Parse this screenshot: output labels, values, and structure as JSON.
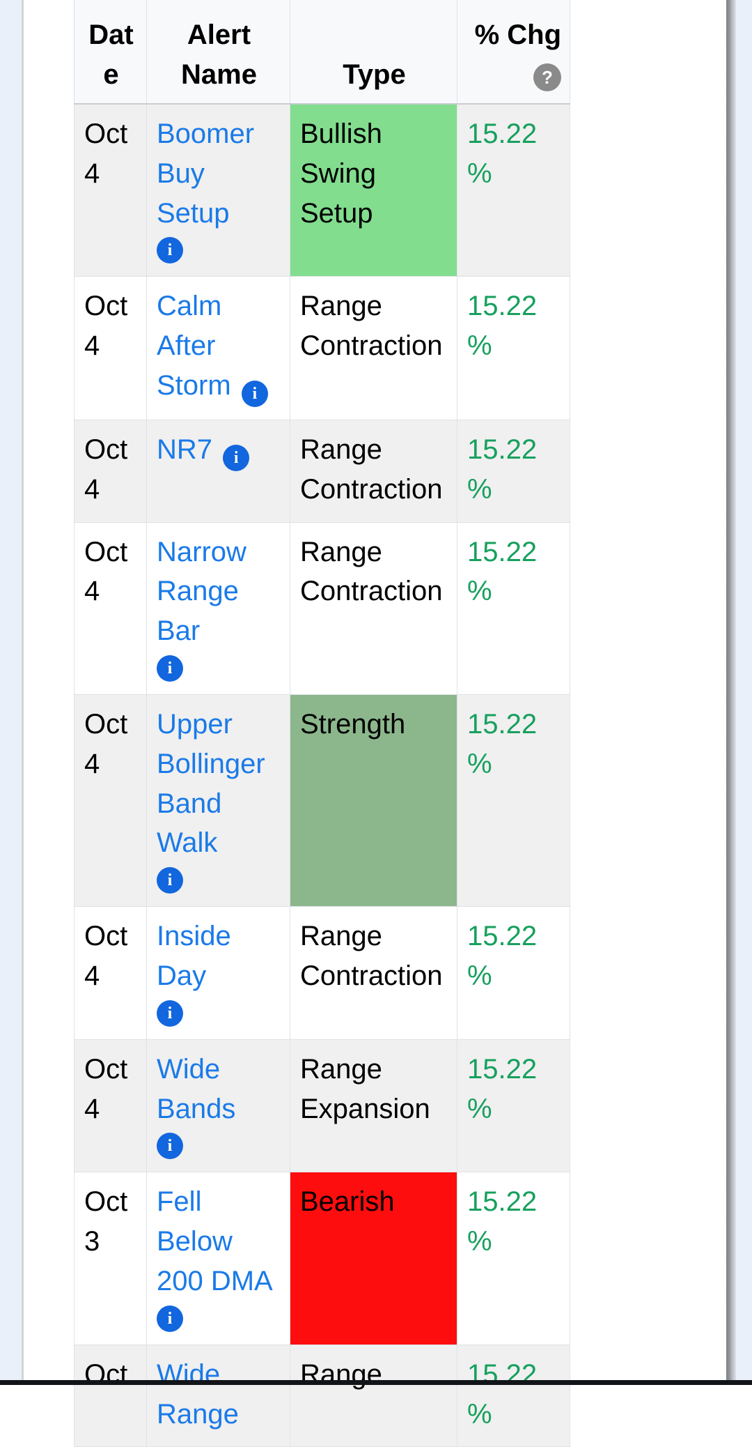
{
  "table": {
    "columns": [
      {
        "key": "date",
        "label": "Date"
      },
      {
        "key": "name",
        "label": "Alert Name"
      },
      {
        "key": "type",
        "label": "Type"
      },
      {
        "key": "chg",
        "label": "% Chg",
        "help_icon": "?"
      }
    ],
    "rows": [
      {
        "date": "Oct 4",
        "name": "Boomer Buy Setup",
        "info_icon": "i",
        "info_layout": "block",
        "type": "Bullish Swing Setup",
        "type_bg": "#82dd8e",
        "chg": "15.22%",
        "shaded": true
      },
      {
        "date": "Oct 4",
        "name": "Calm After Storm",
        "info_icon": "i",
        "info_layout": "inline",
        "type": "Range Contraction",
        "type_bg": "",
        "chg": "15.22%",
        "shaded": false
      },
      {
        "date": "Oct 4",
        "name": "NR7",
        "info_icon": "i",
        "info_layout": "inline",
        "type": "Range Contraction",
        "type_bg": "",
        "chg": "15.22%",
        "shaded": true
      },
      {
        "date": "Oct 4",
        "name": "Narrow Range Bar",
        "info_icon": "i",
        "info_layout": "block",
        "type": "Range Contraction",
        "type_bg": "",
        "chg": "15.22%",
        "shaded": false
      },
      {
        "date": "Oct 4",
        "name": "Upper Bollinger Band Walk",
        "info_icon": "i",
        "info_layout": "block",
        "type": "Strength",
        "type_bg": "#8cb78c",
        "chg": "15.22%",
        "shaded": true
      },
      {
        "date": "Oct 4",
        "name": "Inside Day",
        "info_icon": "i",
        "info_layout": "block",
        "type": "Range Contraction",
        "type_bg": "",
        "chg": "15.22%",
        "shaded": false
      },
      {
        "date": "Oct 4",
        "name": "Wide Bands",
        "info_icon": "i",
        "info_layout": "block",
        "type": "Range Expansion",
        "type_bg": "",
        "chg": "15.22%",
        "shaded": true
      },
      {
        "date": "Oct 3",
        "name": "Fell Below 200 DMA",
        "info_icon": "i",
        "info_layout": "block",
        "type": "Bearish",
        "type_bg": "#fd0d0d",
        "chg": "15.22%",
        "shaded": false
      },
      {
        "date": "Oct",
        "name": "Wide Range",
        "info_icon": "",
        "info_layout": "none",
        "type": "Range",
        "type_bg": "",
        "chg": "15.22%",
        "shaded": true
      }
    ]
  },
  "colors": {
    "link": "#1a7ae8",
    "positive": "#17a05e",
    "info_icon_bg": "#1266de",
    "help_icon_bg": "#8a8a8a",
    "header_bg": "#f8f9fa",
    "row_shaded_bg": "#f0f0f0",
    "page_gutter_bg": "#eaf0f9"
  },
  "scrollbar": {
    "orientation": "vertical",
    "position": "right"
  }
}
